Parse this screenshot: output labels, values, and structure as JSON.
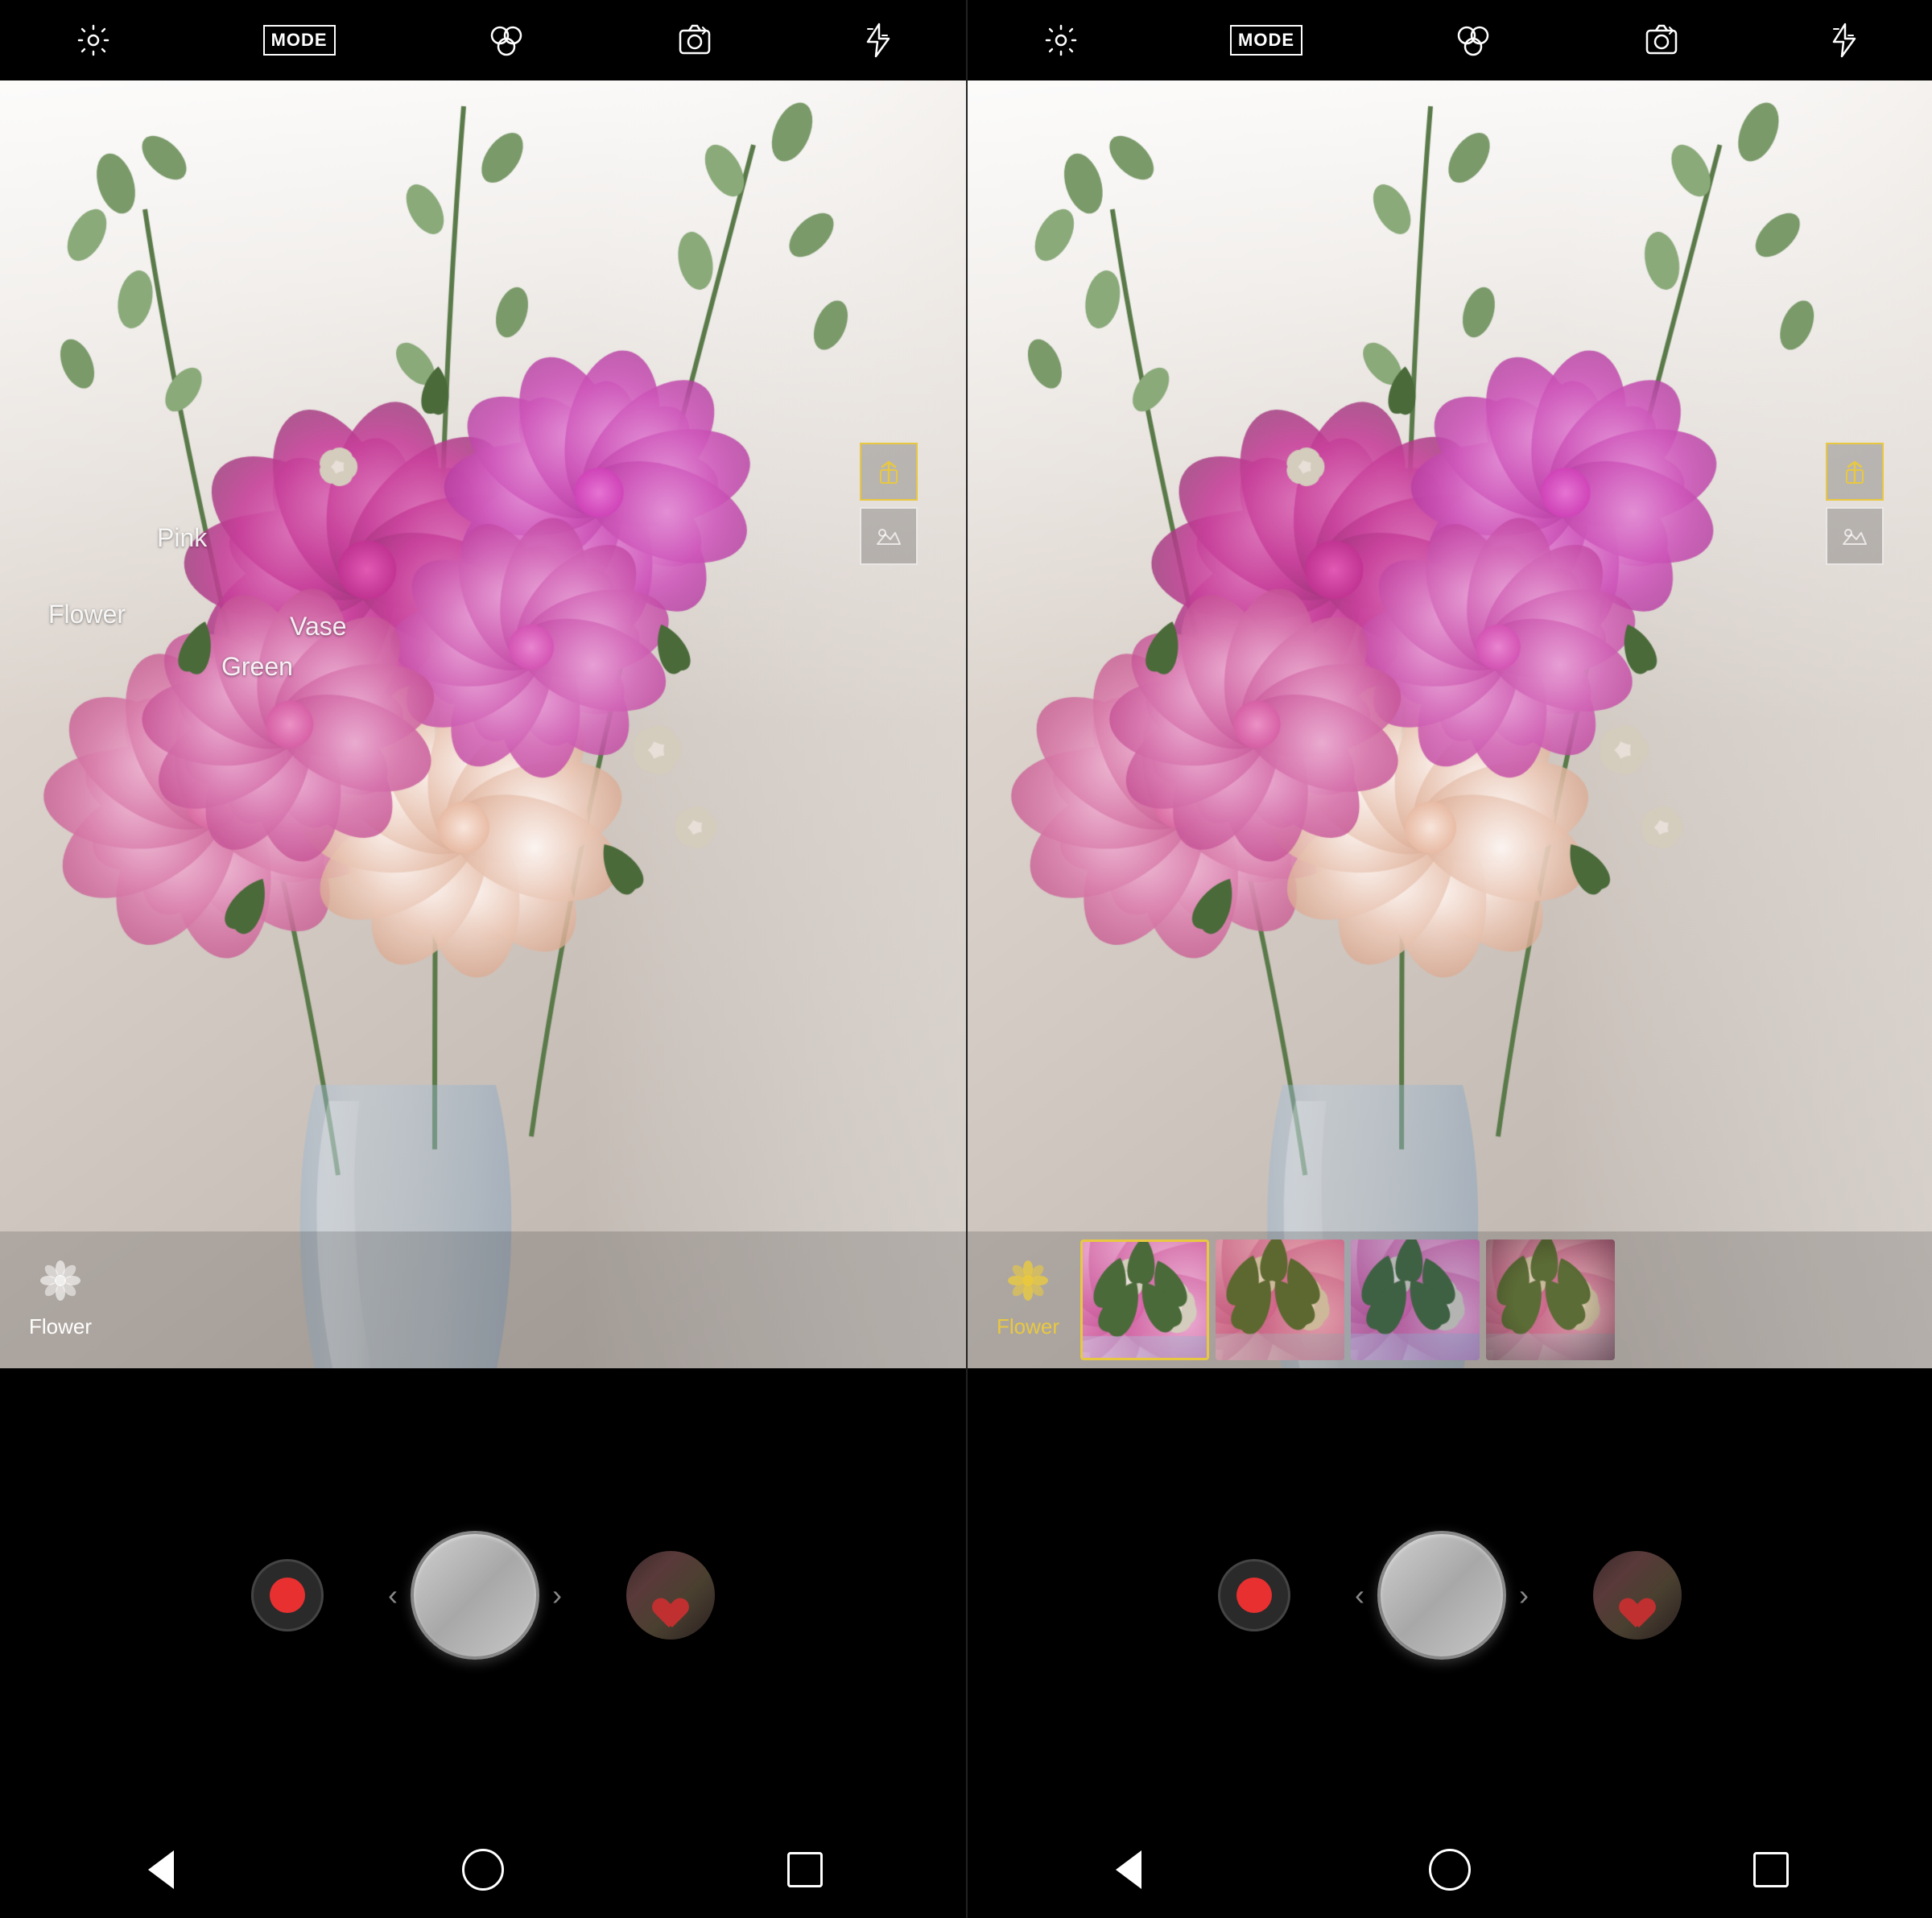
{
  "panels": [
    {
      "id": "panel-left",
      "toolbar": {
        "items": [
          "settings",
          "mode",
          "effects",
          "flip-camera",
          "flash"
        ]
      },
      "labels": [
        {
          "text": "Pink",
          "x": "205",
          "y": "550"
        },
        {
          "text": "Flower",
          "x": "90",
          "y": "645"
        },
        {
          "text": "Vase",
          "x": "375",
          "y": "660"
        },
        {
          "text": "Green",
          "x": "285",
          "y": "700"
        }
      ],
      "focus_icons": [
        {
          "type": "portrait",
          "active": true
        },
        {
          "type": "landscape",
          "active": false
        }
      ],
      "ai_label": {
        "text": "Flower",
        "active": false
      },
      "show_filters": false
    },
    {
      "id": "panel-right",
      "toolbar": {
        "items": [
          "settings",
          "mode",
          "effects",
          "flip-camera",
          "flash"
        ]
      },
      "labels": [],
      "focus_icons": [
        {
          "type": "portrait",
          "active": true
        },
        {
          "type": "landscape",
          "active": false
        }
      ],
      "ai_label": {
        "text": "Flower",
        "active": true
      },
      "show_filters": true,
      "filters": [
        {
          "name": "normal",
          "selected": true
        },
        {
          "name": "warm",
          "selected": false
        },
        {
          "name": "cool",
          "selected": false
        },
        {
          "name": "vintage",
          "selected": false
        }
      ]
    }
  ],
  "controls": {
    "record_label": "record",
    "shutter_label": "shutter",
    "gallery_label": "gallery"
  },
  "nav": {
    "back": "◁",
    "home": "○",
    "recent": "□"
  },
  "mode_label": "MODE"
}
